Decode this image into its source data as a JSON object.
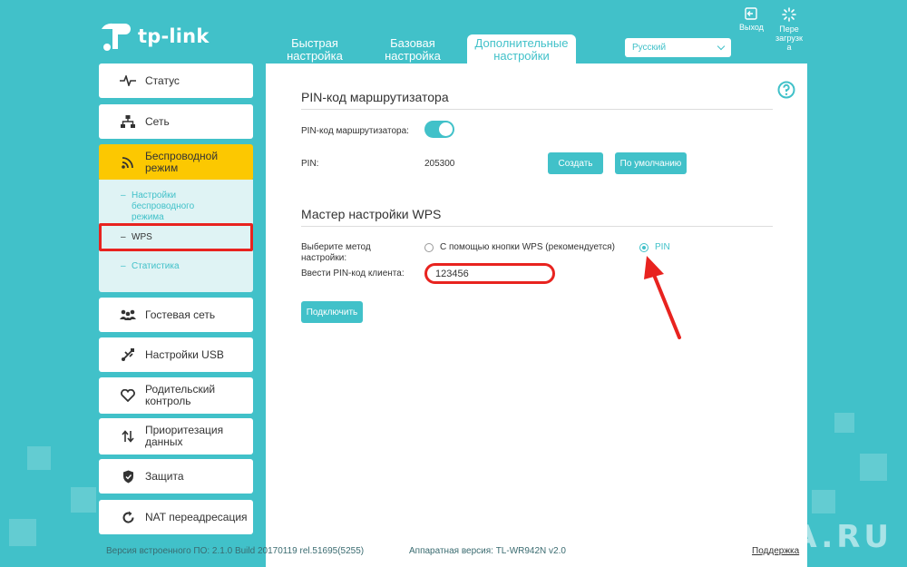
{
  "header": {
    "brand": "tp-link",
    "tabs": [
      {
        "label": "Быстрая настройка"
      },
      {
        "label": "Базовая настройка"
      },
      {
        "label": "Дополнительные настройки"
      }
    ],
    "language": "Русский",
    "logout": "Выход",
    "reboot": "Пере загрузк а"
  },
  "sidebar": {
    "items": [
      {
        "label": "Статус",
        "icon": "pulse-icon"
      },
      {
        "label": "Сеть",
        "icon": "network-icon"
      },
      {
        "label": "Беспроводной режим",
        "icon": "wifi-icon"
      },
      {
        "label": "Гостевая сеть",
        "icon": "guests-icon"
      },
      {
        "label": "Настройки USB",
        "icon": "usb-icon"
      },
      {
        "label": "Родительский контроль",
        "icon": "heart-icon"
      },
      {
        "label": "Приоритезация данных",
        "icon": "sort-arrows-icon"
      },
      {
        "label": "Защита",
        "icon": "shield-icon"
      },
      {
        "label": "NAT переадресация",
        "icon": "refresh-icon"
      }
    ],
    "sub_items": [
      {
        "label": "Настройки беспроводного режима"
      },
      {
        "label": "WPS"
      },
      {
        "label": "Статистика"
      }
    ]
  },
  "router_pin": {
    "title": "PIN-код маршрутизатора",
    "toggle_label": "PIN-код маршрутизатора:",
    "pin_label": "PIN:",
    "pin_value": "205300",
    "generate_button": "Создать",
    "default_button": "По умолчанию"
  },
  "wps_wizard": {
    "title": "Мастер настройки WPS",
    "method_label": "Выберите метод настройки:",
    "option_button": "С помощью кнопки WPS (рекомендуется)",
    "option_pin": "PIN",
    "client_pin_label": "Ввести PIN-код клиента:",
    "client_pin_value": "123456",
    "connect_button": "Подключить"
  },
  "footer": {
    "firmware": "Версия встроенного ПО: 2.1.0 Build 20170119 rel.51695(5255)",
    "hardware": "Аппаратная версия: TL-WR942N v2.0",
    "support": "Поддержка",
    "watermark": "WIFIKA.RU"
  },
  "colors": {
    "teal": "#41c1c9",
    "yellow": "#fcc801",
    "highlight_red": "#e8231f"
  }
}
